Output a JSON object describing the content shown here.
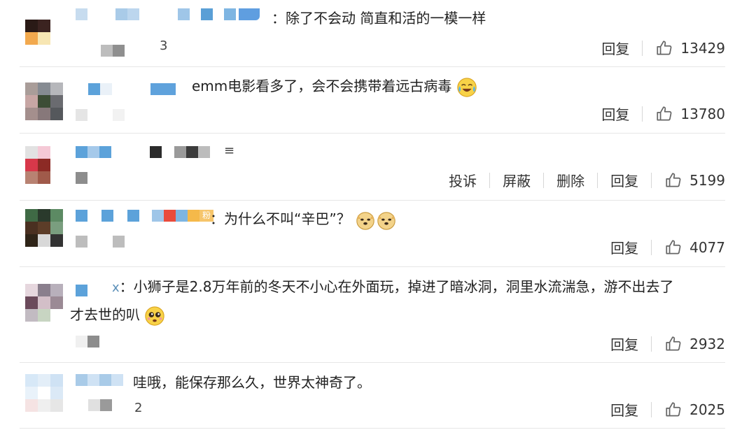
{
  "comments": [
    {
      "text": "：除了不会动 简直和活的一模一样",
      "reply": "回复",
      "likes": "13429",
      "stray": "3"
    },
    {
      "text": "emm电影看多了，会不会携带着远古病毒",
      "emoji": "laugh-cry-emoji",
      "reply": "回复",
      "likes": "13780"
    },
    {
      "stray": "≡",
      "report": "投诉",
      "block": "屏蔽",
      "delete": "删除",
      "reply": "回复",
      "likes": "5199"
    },
    {
      "tag": "粉",
      "text": "：为什么不叫“辛巴”？",
      "emoji": "doge-emoji",
      "reply": "回复",
      "likes": "4077"
    },
    {
      "prefix": "x",
      "text_line1": "：小狮子是2.8万年前的冬天不小心在外面玩，掉进了暗冰洞，洞里水流湍急，游不出去了",
      "text_line2": "才去世的叭",
      "emoji": "pleading-face-emoji",
      "reply": "回复",
      "likes": "2932"
    },
    {
      "text": "哇哦，能保存那么久，世界太神奇了。",
      "reply": "回复",
      "likes": "2025",
      "stray": "2"
    }
  ],
  "colors": {
    "text": "#222222",
    "action": "#333333",
    "divider": "#e6e6e6",
    "mosaic_blue": "#5aa0d8"
  }
}
